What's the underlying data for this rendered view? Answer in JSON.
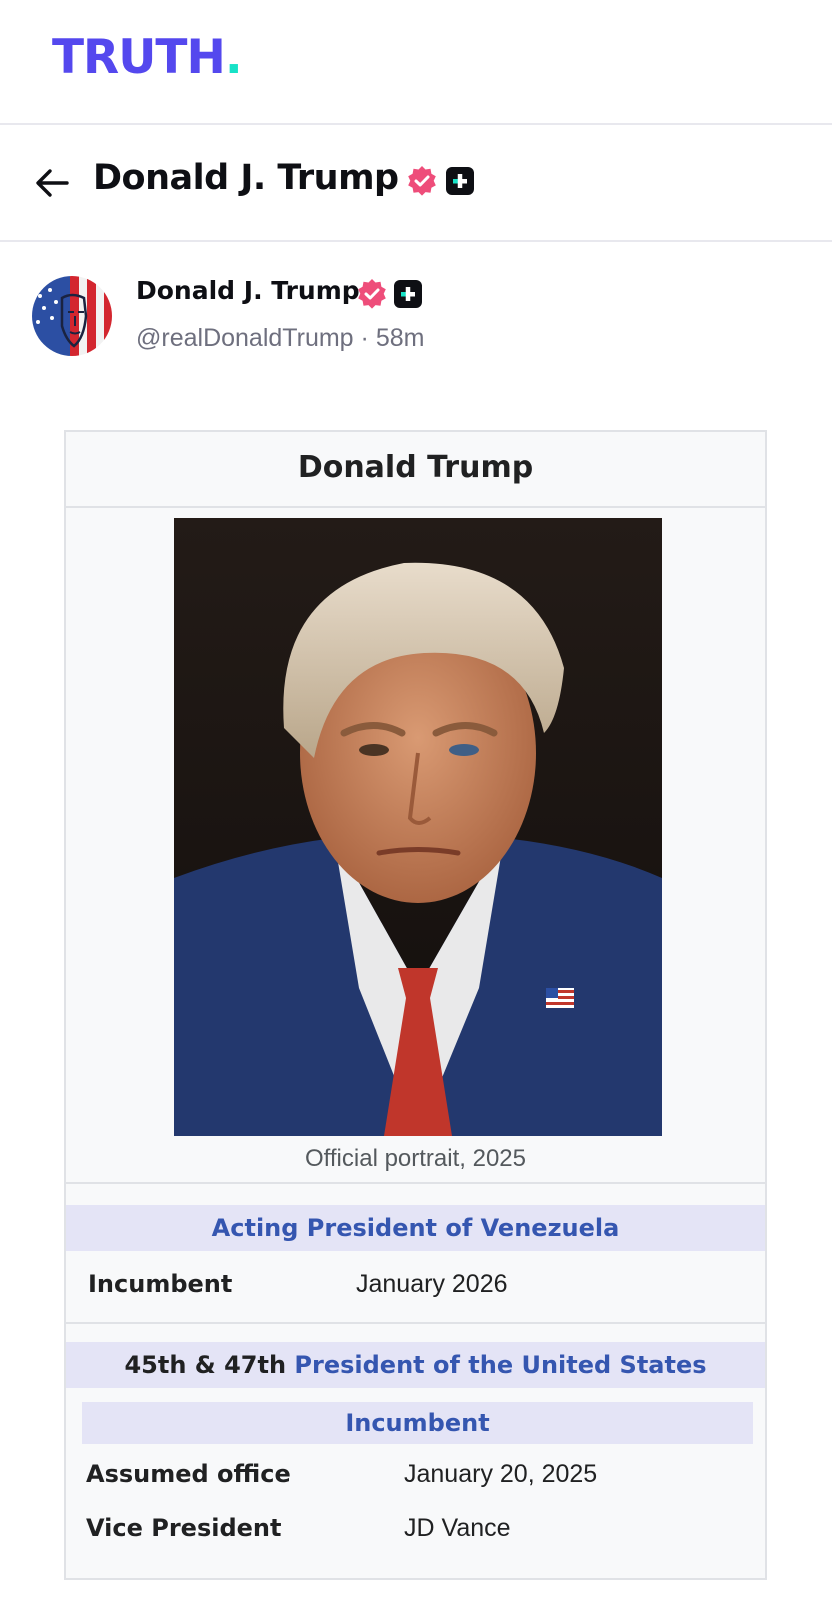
{
  "app": {
    "logo_text": "TRUTH",
    "logo_dot": ".",
    "brand_color": "#5448ee",
    "accent_color": "#17e2c7",
    "verified_color": "#ee4d7a"
  },
  "header": {
    "back_icon": "arrow-left-icon",
    "display_name": "Donald J. Trump",
    "badges": [
      "verified-badge-icon",
      "truth-plus-icon"
    ]
  },
  "post": {
    "author_name": "Donald J. Trump",
    "handle": "@realDonaldTrump",
    "separator": "·",
    "time_ago": "58m",
    "avatar_icon": "flag-face-avatar"
  },
  "infobox": {
    "title": "Donald Trump",
    "image_caption": "Official portrait, 2025",
    "section1": {
      "heading": "Acting President of Venezuela",
      "label": "Incumbent",
      "value": "January 2026"
    },
    "section2": {
      "heading_prefix": "45th & 47th",
      "heading_link": "President of the United States",
      "subheading": "Incumbent",
      "rows": [
        {
          "label": "Assumed office",
          "value": "January 20, 2025"
        },
        {
          "label": "Vice President",
          "value": "JD Vance"
        }
      ]
    }
  }
}
